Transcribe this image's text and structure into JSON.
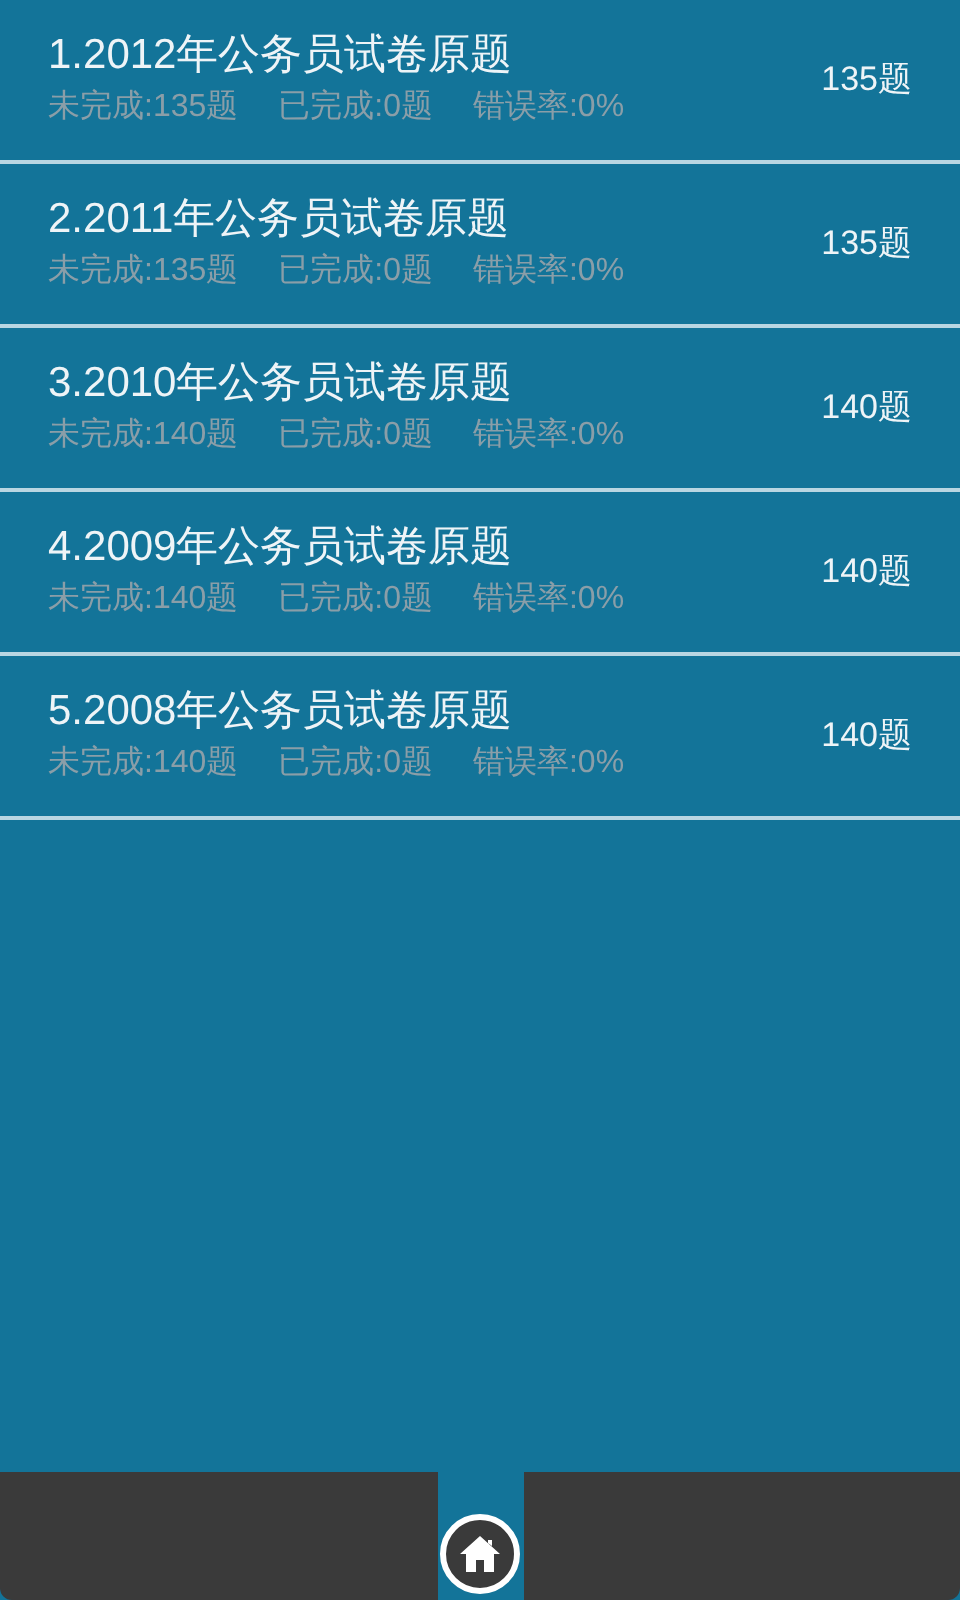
{
  "papers": [
    {
      "title": "1.2012年公务员试卷原题",
      "unfinished": "未完成:135题",
      "finished": "已完成:0题",
      "error_rate": "错误率:0%",
      "count": "135题"
    },
    {
      "title": "2.2011年公务员试卷原题",
      "unfinished": "未完成:135题",
      "finished": "已完成:0题",
      "error_rate": "错误率:0%",
      "count": "135题"
    },
    {
      "title": "3.2010年公务员试卷原题",
      "unfinished": "未完成:140题",
      "finished": "已完成:0题",
      "error_rate": "错误率:0%",
      "count": "140题"
    },
    {
      "title": "4.2009年公务员试卷原题",
      "unfinished": "未完成:140题",
      "finished": "已完成:0题",
      "error_rate": "错误率:0%",
      "count": "140题"
    },
    {
      "title": "5.2008年公务员试卷原题",
      "unfinished": "未完成:140题",
      "finished": "已完成:0题",
      "error_rate": "错误率:0%",
      "count": "140题"
    }
  ]
}
